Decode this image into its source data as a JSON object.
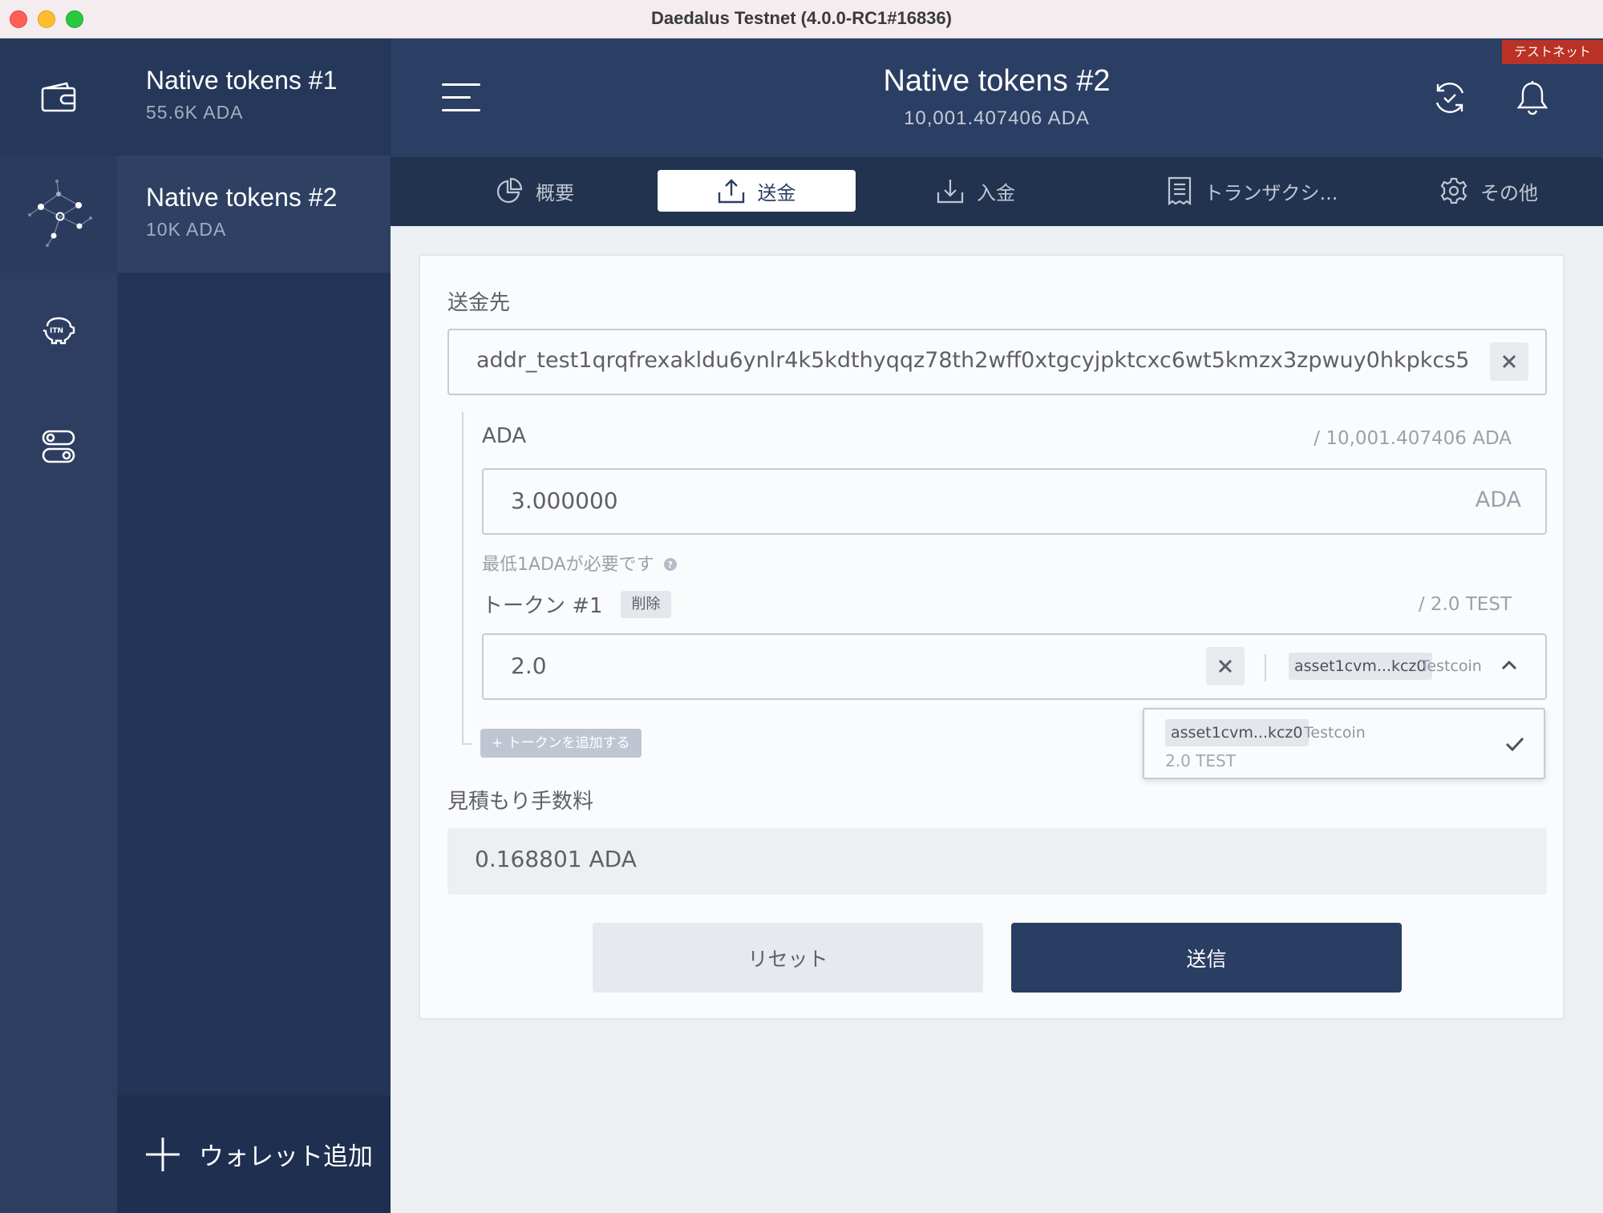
{
  "window": {
    "title": "Daedalus Testnet (4.0.0-RC1#16836)"
  },
  "wallets": [
    {
      "name": "Native tokens #1",
      "balance": "55.6K ADA"
    },
    {
      "name": "Native tokens #2",
      "balance": "10K ADA"
    }
  ],
  "sidebar": {
    "add_wallet_label": "ウォレット追加",
    "add_wallet_icon": "plus-icon",
    "itn_label": "ITN"
  },
  "header": {
    "wallet_name": "Native tokens #2",
    "wallet_amount": "10,001.407406 ADA",
    "testnet_badge": "テストネット"
  },
  "tabs": [
    {
      "label": "概要",
      "icon": "pie-chart-icon",
      "active": false
    },
    {
      "label": "送金",
      "icon": "upload-icon",
      "active": true
    },
    {
      "label": "入金",
      "icon": "download-icon",
      "active": false
    },
    {
      "label": "トランザクシ...",
      "icon": "receipt-icon",
      "active": false
    },
    {
      "label": "その他",
      "icon": "gear-icon",
      "active": false
    }
  ],
  "form": {
    "receiver_label": "送金先",
    "receiver_value": "addr_test1qrqfrexakldu6ynlr4k5kdthyqqz78th2wff0xtgcyjpktcxc6wt5kmzx3zpwuy0hkpkcs5k...",
    "ada_label": "ADA",
    "ada_available": "/ 10,001.407406 ADA",
    "ada_value": "3.000000",
    "ada_unit": "ADA",
    "min_ada_note": "最低1ADAが必要です",
    "token_label": "トークン #1",
    "remove_label": "削除",
    "token_available": "/ 2.0 TEST",
    "token_value": "2.0",
    "token_asset_id": "asset1cvm...kcz0",
    "token_asset_name": "Testcoin",
    "add_token_label": "+ トークンを追加する",
    "dropdown_option": {
      "asset_id": "asset1cvm...kcz0",
      "asset_name": "Testcoin",
      "amount": "2.0 TEST"
    },
    "fee_label": "見積もり手数料",
    "fee_value": "0.168801 ADA",
    "reset_label": "リセット",
    "send_label": "送信"
  },
  "colors": {
    "sidebar": "#2d3e61",
    "walletlist": "#233556",
    "header": "#2b3e63",
    "tabbar": "#22334f",
    "content_bg": "#edf0f3",
    "primary_button": "#2a3d62",
    "testnet_badge": "#ba3225"
  }
}
